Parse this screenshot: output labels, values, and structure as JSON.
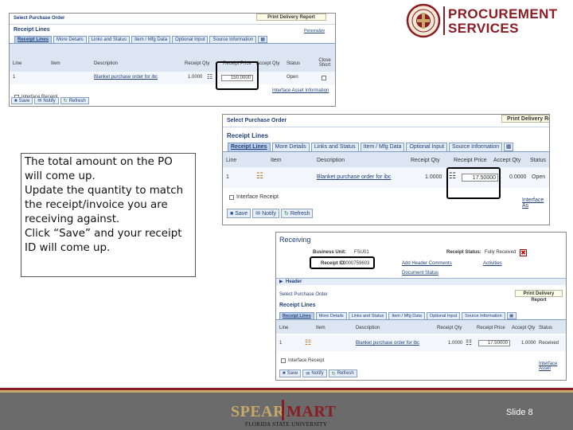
{
  "logo": {
    "line1": "PROCUREMENT",
    "line2": "SERVICES"
  },
  "note": {
    "lines": [
      "The total amount on the PO will come up.",
      "Update the quantity to match the receipt/invoice you are receiving against.",
      "Click “Save” and your receipt ID will come up."
    ]
  },
  "shot1": {
    "title": "Select Purchase Order",
    "print_button": "Print Delivery Report",
    "section": "Receipt Lines",
    "personalize": "Personalize",
    "tabs": [
      "Receipt Lines",
      "More Details",
      "Links and Status",
      "Item / Mfg Data",
      "Optional Input",
      "Source Information"
    ],
    "headers": [
      "Line",
      "Item",
      "Description",
      "Receipt Qty",
      "Receipt Price",
      "Accept Qty",
      "Status",
      "Close Short"
    ],
    "row": {
      "line": "1",
      "description": "Blanket purchase order for ibc",
      "receipt_qty": "1.0000",
      "receipt_price": "150.0000",
      "status": "Open"
    },
    "interface_receipt": "Interface Receipt",
    "interface_link": "Interface Asset Information",
    "buttons": [
      "Save",
      "Notify",
      "Refresh"
    ]
  },
  "shot2": {
    "title": "Select Purchase Order",
    "print_button": "Print Delivery Rep",
    "section": "Receipt Lines",
    "tabs": [
      "Receipt Lines",
      "More Details",
      "Links and Status",
      "Item / Mfg Data",
      "Optional Input",
      "Source Information"
    ],
    "headers": [
      "Line",
      "Item",
      "Description",
      "Receipt Qty",
      "Receipt Price",
      "Accept Qty",
      "Status"
    ],
    "row": {
      "line": "1",
      "description": "Blanket purchase order for ibc",
      "receipt_qty": "1.0000",
      "receipt_price": "17.50000",
      "accept_qty": "0.0000",
      "status": "Open"
    },
    "interface_receipt": "Interface Receipt",
    "interface_link": "Interface As",
    "buttons": [
      "Save",
      "Notify",
      "Refresh"
    ]
  },
  "shot3": {
    "title": "Receiving",
    "business_unit_label": "Business Unit:",
    "business_unit": "FSU01",
    "receipt_status_label": "Receipt Status:",
    "receipt_status": "Fully Received",
    "receipt_id_label": "Receipt ID:",
    "receipt_id": "0000759603",
    "header_comments": "Add Header Comments",
    "activities": "Activities",
    "document_status": "Document Status",
    "header_section": "Header",
    "select_po": "Select Purchase Order",
    "print_button": "Print Delivery Report",
    "section": "Receipt Lines",
    "tabs": [
      "Receipt Lines",
      "More Details",
      "Links and Status",
      "Item / Mfg Data",
      "Optional Input",
      "Source Information"
    ],
    "headers": [
      "Line",
      "Item",
      "Description",
      "Receipt Qty",
      "Receipt Price",
      "Accept Qty",
      "Status"
    ],
    "row": {
      "line": "1",
      "description": "Blanket purchase order for ibc",
      "receipt_qty": "1.0000",
      "receipt_price": "17.50000",
      "accept_qty": "1.0000",
      "status": "Received"
    },
    "interface_receipt": "Interface Receipt",
    "interface_link": "Interface Asset",
    "buttons": [
      "Save",
      "Notify",
      "Refresh"
    ]
  },
  "footer": {
    "brand_left": "SPEAR",
    "brand_right": "MART",
    "university": "FLORIDA STATE UNIVERSITY",
    "slide": "Slide 8"
  },
  "colors": {
    "garnet": "#8a1c24",
    "gold": "#c9a96a",
    "footer_bg": "#6b6b6b",
    "ps_blue": "#1f3f7a"
  }
}
